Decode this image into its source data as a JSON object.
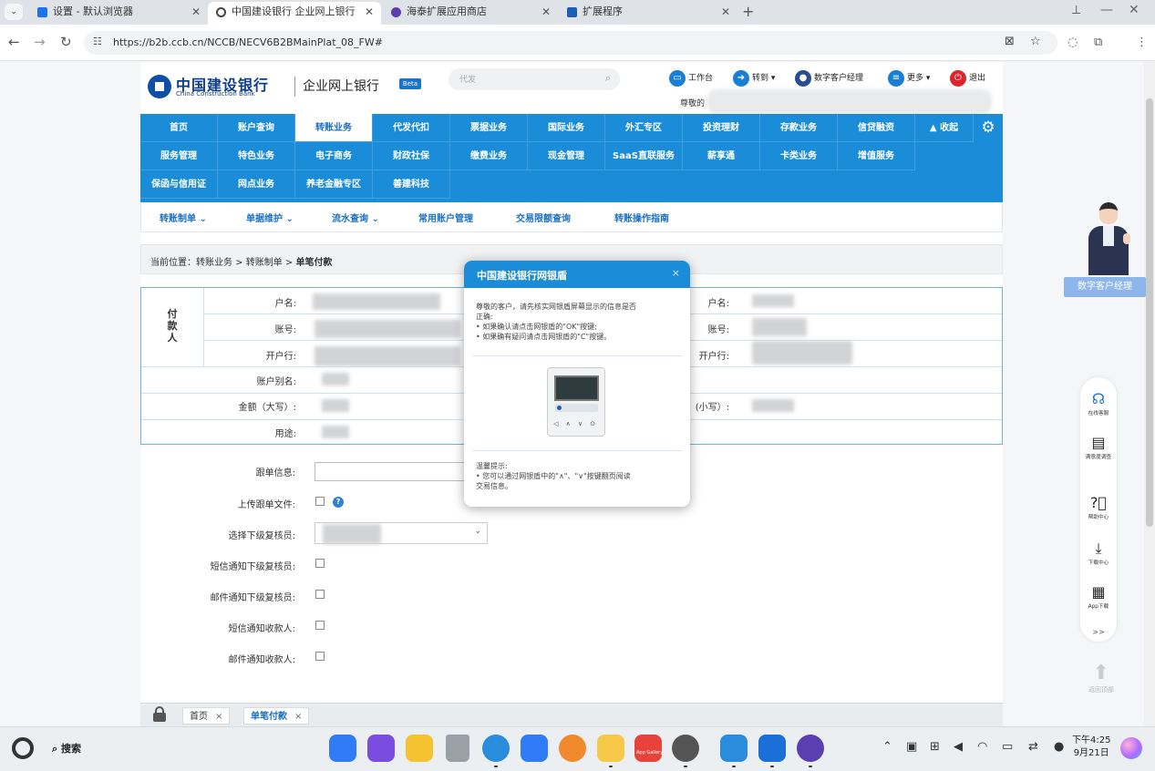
{
  "browser": {
    "tabs": [
      {
        "title": "设置 - 默认浏览器",
        "icon": "gear-icon",
        "color": "#1a73e8"
      },
      {
        "title": "中国建设银行 企业网上银行",
        "icon": "globe-icon",
        "color": "#444444"
      },
      {
        "title": "海泰扩展应用商店",
        "icon": "store-icon",
        "color": "#5b3fb0"
      },
      {
        "title": "扩展程序",
        "icon": "puzzle-icon",
        "color": "#1a5fb4"
      }
    ],
    "url": "https://b2b.ccb.cn/NCCB/NECV6B2BMainPlat_08_FW#"
  },
  "header": {
    "logo_cn": "中国建设银行",
    "logo_en": "China Construction Bank",
    "subtitle": "企业网上银行",
    "beta": "Beta",
    "search_placeholder": "代发",
    "links": [
      {
        "label": "工作台",
        "icon": "monitor-icon",
        "color": "#1a7fd4"
      },
      {
        "label": "转到 ▾",
        "icon": "arrow-circle-icon",
        "color": "#1a7fd4"
      },
      {
        "label": "数字客户经理",
        "icon": "person-icon",
        "color": "#2a4f8f"
      },
      {
        "label": "更多 ▾",
        "icon": "list-icon",
        "color": "#1a7fd4"
      },
      {
        "label": "退出",
        "icon": "power-icon",
        "color": "#d9262c"
      }
    ],
    "greeting": "尊敬的"
  },
  "nav": {
    "row1": [
      "首页",
      "账户查询",
      "转账业务",
      "代发代扣",
      "票据业务",
      "国际业务",
      "外汇专区",
      "投资理财",
      "存款业务",
      "信贷融资",
      "▲ 收起"
    ],
    "row2": [
      "服务管理",
      "特色业务",
      "电子商务",
      "财政社保",
      "缴费业务",
      "现金管理",
      "SaaS直联服务",
      "薪享通",
      "卡类业务",
      "增值服务"
    ],
    "row3": [
      "保函与信用证",
      "网点业务",
      "养老金融专区",
      "善建科技"
    ],
    "active": "转账业务"
  },
  "subnav": [
    "转账制单 ⌄",
    "单据维护 ⌄",
    "流水查询 ⌄",
    "常用账户管理",
    "交易限额查询",
    "转账操作指南"
  ],
  "breadcrumb": {
    "prefix": "当前位置：",
    "path": "转账业务 > 转账制单 > ",
    "current": "单笔付款"
  },
  "form": {
    "payer": "付\n款\n人",
    "payer_labels": [
      "户名:",
      "账号:",
      "开户行:"
    ],
    "payee_labels": [
      "户名:",
      "账号:",
      "开户行:"
    ],
    "alias_label": "账户别名:",
    "amount_upper_label": "金额（大写）:",
    "amount_lower_label": "(小写）:",
    "purpose_label": "用途:",
    "extra_labels": [
      "跟单信息:",
      "上传跟单文件:",
      "选择下级复核员:",
      "短信通知下级复核员:",
      "邮件通知下级复核员:",
      "短信通知收款人:",
      "邮件通知收款人:"
    ]
  },
  "modal": {
    "title": "中国建设银行网银盾",
    "close": "×",
    "body": [
      "尊敬的客户，请先核实网银盾屏幕显示的信息是否",
      "正确:",
      "• 如果确认请点击网银盾的\"OK\"按键;",
      "• 如果确有疑问请点击网银盾的\"C\"按键。"
    ],
    "tip_title": "温馨提示:",
    "tip": [
      "• 您可以通过网银盾中的\"∧\"、\"∨\"按键翻页阅读",
      "交易信息。"
    ],
    "device_keys": "◁ ∧ ∨ ⊙"
  },
  "page_tabs": [
    {
      "label": "首页",
      "close": "×"
    },
    {
      "label": "单笔付款",
      "close": "×"
    }
  ],
  "side": {
    "digital_manager": "数字客户经理",
    "items": [
      {
        "label": "在线客服",
        "icon": "headset-icon"
      },
      {
        "label": "满意度调查",
        "icon": "clipboard-icon"
      },
      {
        "label": "帮助中心",
        "icon": "help-icon"
      },
      {
        "label": "下载中心",
        "icon": "download-icon"
      },
      {
        "label": "App下载",
        "icon": "qrcode-icon"
      }
    ],
    "more": ">>",
    "back_top": "返回顶部"
  },
  "taskbar": {
    "search": "搜索",
    "time": "下午4:25",
    "date": "9月21日",
    "apps": [
      {
        "name": "app-launcher-icon",
        "color": "#2f7cf6"
      },
      {
        "name": "multitask-icon",
        "color": "#7a4de0"
      },
      {
        "name": "files-icon",
        "color": "#f5c230"
      },
      {
        "name": "trash-icon",
        "color": "#9aa0a6"
      },
      {
        "name": "browser-icon",
        "color": "#2a8cdc"
      },
      {
        "name": "mail-icon",
        "color": "#2f7cf6"
      },
      {
        "name": "photos-icon",
        "color": "#f08a2c"
      },
      {
        "name": "notes-icon",
        "color": "#f7c948"
      },
      {
        "name": "app-store-icon",
        "color": "#e8423c"
      },
      {
        "name": "settings-icon",
        "color": "#555555"
      },
      {
        "name": "screenshot-icon",
        "color": "#2a8cdc"
      },
      {
        "name": "ccb-icon",
        "color": "#1a6fd8"
      },
      {
        "name": "haitai-icon",
        "color": "#5b3fb0"
      }
    ],
    "app_store_label": "App Gallery"
  }
}
